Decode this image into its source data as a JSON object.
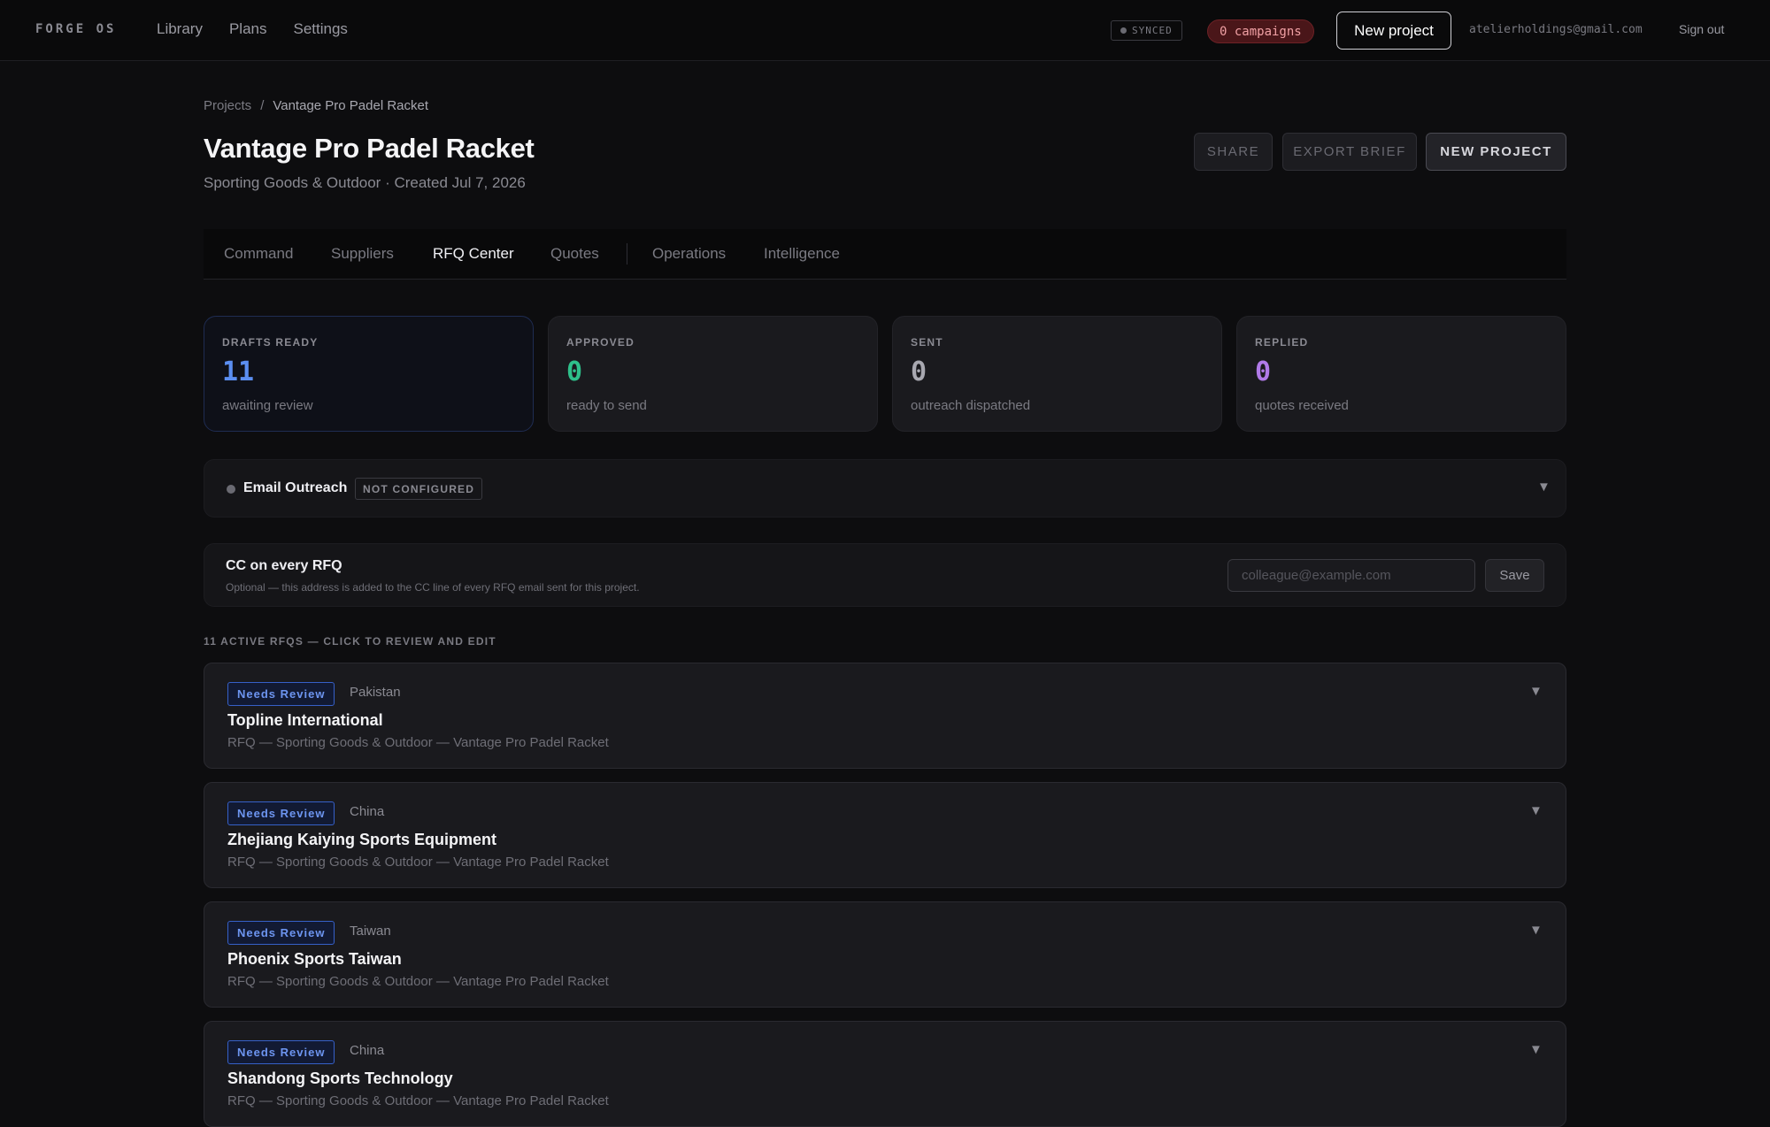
{
  "topbar": {
    "brand": "FORGE OS",
    "nav": [
      "Library",
      "Plans",
      "Settings"
    ],
    "sync_status": "SYNCED",
    "campaigns": "0 campaigns",
    "new_project": "New project",
    "user_email": "atelierholdings@gmail.com",
    "sign_out": "Sign out"
  },
  "breadcrumb": {
    "root": "Projects",
    "separator": "/",
    "current": "Vantage Pro Padel Racket"
  },
  "page": {
    "title": "Vantage Pro Padel Racket",
    "subtitle": "Sporting Goods & Outdoor · Created Jul 7, 2026"
  },
  "actions": {
    "share": "SHARE",
    "export": "EXPORT BRIEF",
    "new_project": "NEW PROJECT"
  },
  "tabs": [
    {
      "label": "Command"
    },
    {
      "label": "Suppliers"
    },
    {
      "label": "RFQ Center",
      "active": true
    },
    {
      "label": "Quotes"
    },
    {
      "label": "Operations"
    },
    {
      "label": "Intelligence"
    }
  ],
  "stats": [
    {
      "label": "DRAFTS READY",
      "value": "11",
      "desc": "awaiting review",
      "color": "#5b8ef0"
    },
    {
      "label": "APPROVED",
      "value": "0",
      "desc": "ready to send",
      "color": "#2ec08a"
    },
    {
      "label": "SENT",
      "value": "0",
      "desc": "outreach dispatched",
      "color": "#a8a8b0"
    },
    {
      "label": "REPLIED",
      "value": "0",
      "desc": "quotes received",
      "color": "#b07ae8"
    }
  ],
  "outreach": {
    "title": "Email Outreach",
    "status": "NOT CONFIGURED"
  },
  "cc": {
    "title": "CC on every RFQ",
    "desc": "Optional — this address is added to the CC line of every RFQ email sent for this project.",
    "placeholder": "colleague@example.com",
    "value": "",
    "save": "Save"
  },
  "rfq_section_label": "11 ACTIVE RFQS — CLICK TO REVIEW AND EDIT",
  "rfqs": [
    {
      "status": "Needs Review",
      "country": "Pakistan",
      "name": "Topline International",
      "subject": "RFQ — Sporting Goods & Outdoor — Vantage Pro Padel Racket"
    },
    {
      "status": "Needs Review",
      "country": "China",
      "name": "Zhejiang Kaiying Sports Equipment",
      "subject": "RFQ — Sporting Goods & Outdoor — Vantage Pro Padel Racket"
    },
    {
      "status": "Needs Review",
      "country": "Taiwan",
      "name": "Phoenix Sports Taiwan",
      "subject": "RFQ — Sporting Goods & Outdoor — Vantage Pro Padel Racket"
    },
    {
      "status": "Needs Review",
      "country": "China",
      "name": "Shandong Sports Technology",
      "subject": "RFQ — Sporting Goods & Outdoor — Vantage Pro Padel Racket"
    }
  ],
  "icons": {
    "chevron": "chevron-down-icon",
    "status_dot": "status-dot-icon"
  }
}
